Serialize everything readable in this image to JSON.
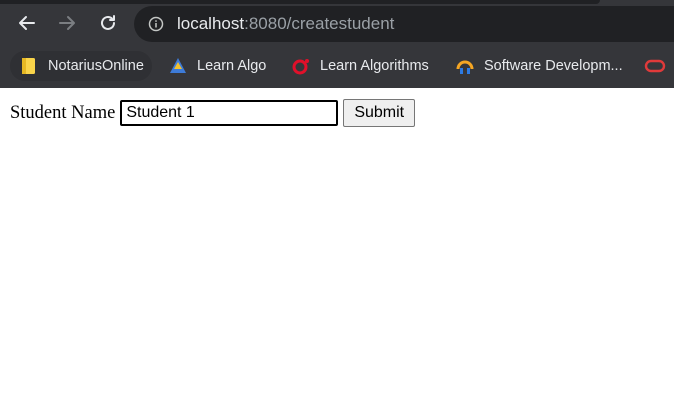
{
  "browser": {
    "nav": {
      "back_icon": "arrow-left-icon",
      "forward_icon": "arrow-right-icon",
      "reload_icon": "reload-icon"
    },
    "address_bar": {
      "host": "localhost",
      "rest": ":8080/createstudent",
      "info_icon": "info-icon"
    },
    "bookmarks": [
      {
        "label": "NotariusOnline",
        "icon": "folder-icon"
      },
      {
        "label": "Learn Algo",
        "icon": "learn-algo-icon"
      },
      {
        "label": "Learn Algorithms",
        "icon": "opera-icon"
      },
      {
        "label": "Software Developm...",
        "icon": "software-dev-icon"
      }
    ]
  },
  "form": {
    "label": "Student Name",
    "input_value": "Student 1",
    "submit_label": "Submit"
  },
  "colors": {
    "chrome_bg": "#35363a",
    "omnibox_bg": "#202124",
    "text_light": "#e8eaed",
    "text_dim": "#9aa0a6"
  }
}
